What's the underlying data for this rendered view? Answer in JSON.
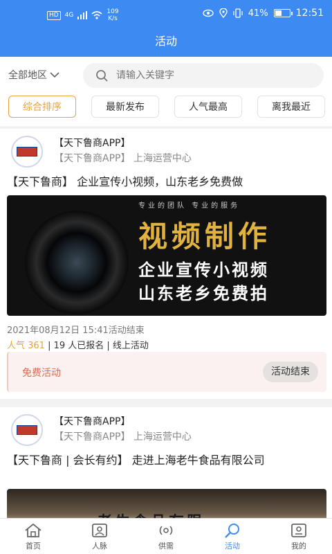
{
  "status_bar": {
    "hd": "HD",
    "signal": "4G",
    "net_speed_value": "109",
    "net_speed_unit": "K/s",
    "battery": "41%",
    "time": "12:51"
  },
  "header": {
    "title": "活动"
  },
  "search": {
    "region": "全部地区",
    "placeholder": "请输入关键字"
  },
  "filters": [
    "综合排序",
    "最新发布",
    "人气最高",
    "离我最近"
  ],
  "posts": [
    {
      "org_name": "【天下鲁商APP】",
      "org_sub": "【天下鲁商APP】 上海运营中心",
      "title": "【天下鲁商】 企业宣传小视频，山东老乡免费做",
      "banner_top": "专业的团队 专业的服务",
      "banner_big": "视频制作",
      "banner_line1": "企业宣传小视频",
      "banner_line2": "山东老乡免费拍",
      "date": "2021年08月12日 15:41活动结束",
      "popularity": "人气 361",
      "stats": " | 19 人已报名 | 线上活动",
      "free_label": "免费活动",
      "status_button": "活动结束"
    },
    {
      "org_name": "【天下鲁商APP】",
      "org_sub": "【天下鲁商APP】 上海运营中心",
      "title": "【天下鲁商 | 会长有约】 走进上海老牛食品有限公司",
      "banner_sign": "老牛食品有限"
    }
  ],
  "tabs": [
    "首页",
    "人脉",
    "供需",
    "活动",
    "我的"
  ],
  "colors": {
    "primary": "#3d8bf2",
    "accent": "#e7a33e",
    "free": "#e06a4e"
  }
}
